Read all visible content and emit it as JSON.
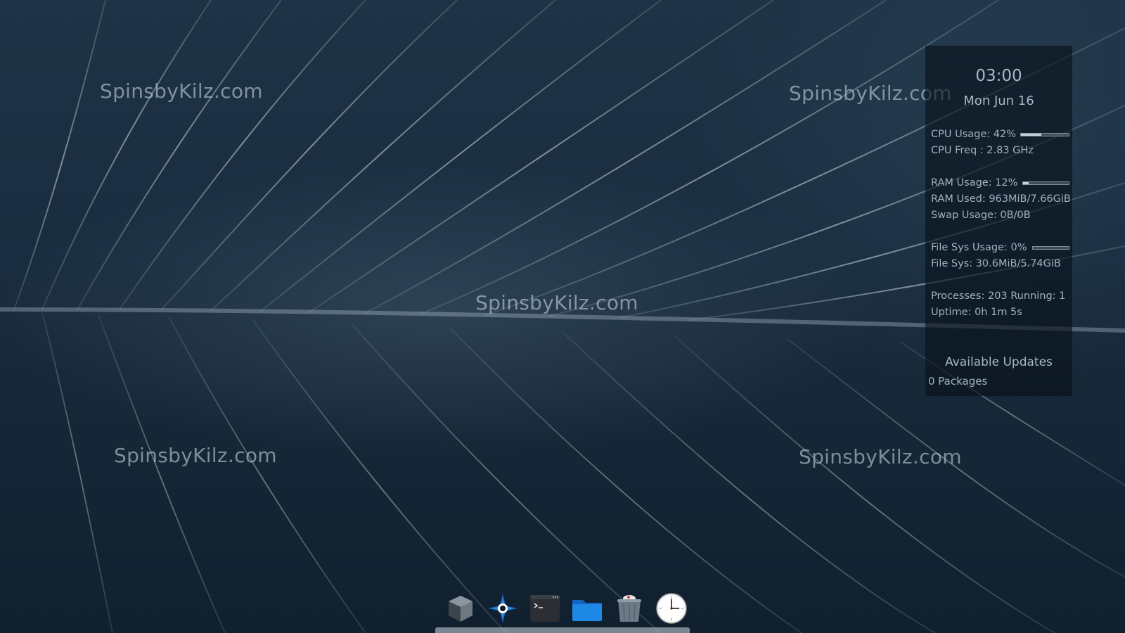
{
  "watermarks": [
    "SpinsbyKilz.com",
    "SpinsbyKilz.com",
    "SpinsbyKilz.com",
    "SpinsbyKilz.com",
    "SpinsbyKilz.com"
  ],
  "conky": {
    "time": "03:00",
    "date": "Mon Jun 16",
    "cpu_usage": "CPU Usage: 42%",
    "cpu_usage_percent": 42,
    "cpu_freq": "CPU Freq : 2.83 GHz",
    "ram_usage": "RAM Usage: 12%",
    "ram_usage_percent": 12,
    "ram_used": "RAM Used: 963MiB/7.66GiB",
    "swap_usage": "Swap Usage: 0B/0B",
    "fs_usage": "File Sys Usage:  0%",
    "fs_usage_percent": 0,
    "fs": "File Sys: 30.6MiB/5.74GiB",
    "processes": "Processes: 203   Running: 1",
    "uptime": "Uptime: 0h 1m 5s",
    "updates_title": "Available Updates",
    "updates_count": "0 Packages"
  },
  "dock": {
    "items": [
      {
        "name": "application-launcher-icon"
      },
      {
        "name": "settings-compass-icon"
      },
      {
        "name": "terminal-icon"
      },
      {
        "name": "file-manager-folder-icon"
      },
      {
        "name": "trash-icon"
      },
      {
        "name": "clock-icon"
      }
    ]
  },
  "colors": {
    "conky_text": "#9fb1c0",
    "folder_blue": "#1e88e5",
    "compass_blue": "#1565c0"
  }
}
